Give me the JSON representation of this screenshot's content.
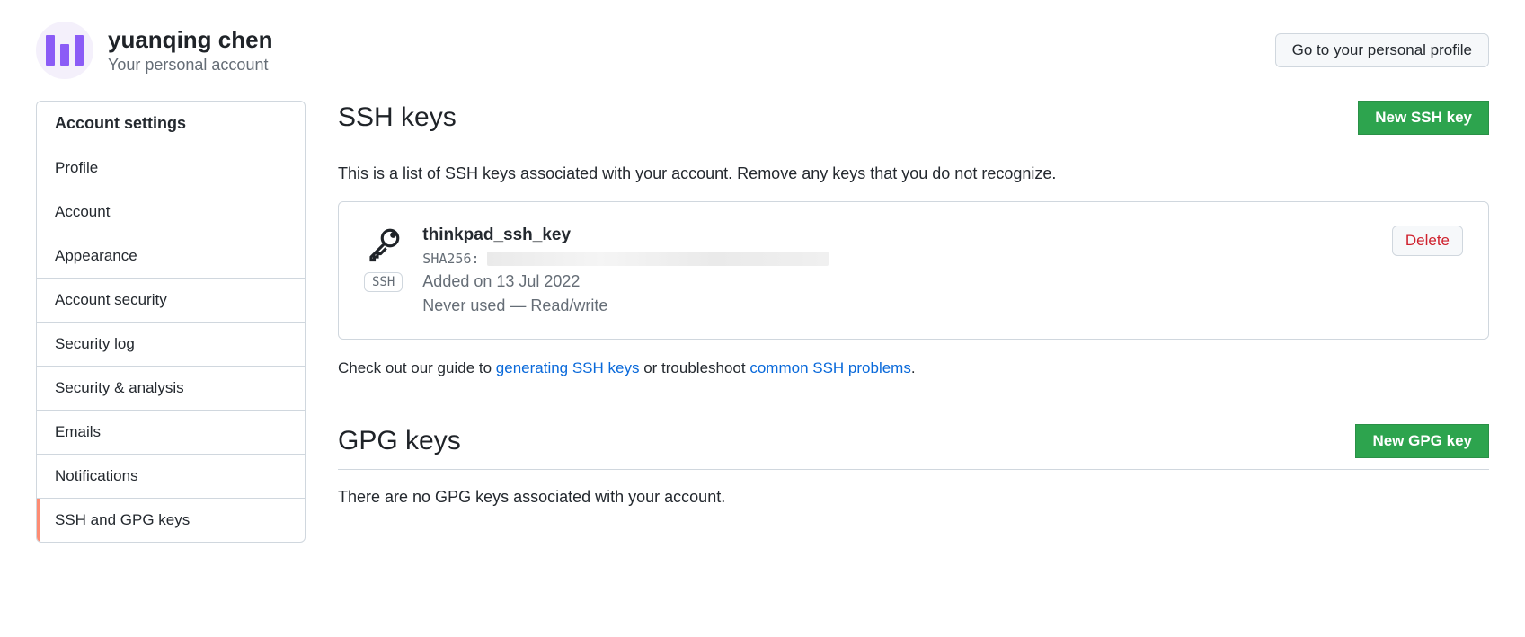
{
  "header": {
    "username": "yuanqing chen",
    "subtitle": "Your personal account",
    "profile_button": "Go to your personal profile"
  },
  "sidebar": {
    "heading": "Account settings",
    "items": [
      {
        "label": "Profile"
      },
      {
        "label": "Account"
      },
      {
        "label": "Appearance"
      },
      {
        "label": "Account security"
      },
      {
        "label": "Security log"
      },
      {
        "label": "Security & analysis"
      },
      {
        "label": "Emails"
      },
      {
        "label": "Notifications"
      },
      {
        "label": "SSH and GPG keys"
      }
    ]
  },
  "ssh": {
    "title": "SSH keys",
    "new_button": "New SSH key",
    "description": "This is a list of SSH keys associated with your account. Remove any keys that you do not recognize.",
    "key": {
      "name": "thinkpad_ssh_key",
      "fingerprint_prefix": "SHA256:",
      "badge": "SSH",
      "added": "Added on 13 Jul 2022",
      "usage": "Never used — Read/write",
      "delete_label": "Delete"
    },
    "guide_prefix": "Check out our guide to ",
    "guide_link": "generating SSH keys",
    "guide_mid": " or troubleshoot ",
    "guide_link2": "common SSH problems",
    "guide_suffix": "."
  },
  "gpg": {
    "title": "GPG keys",
    "new_button": "New GPG key",
    "empty": "There are no GPG keys associated with your account."
  }
}
